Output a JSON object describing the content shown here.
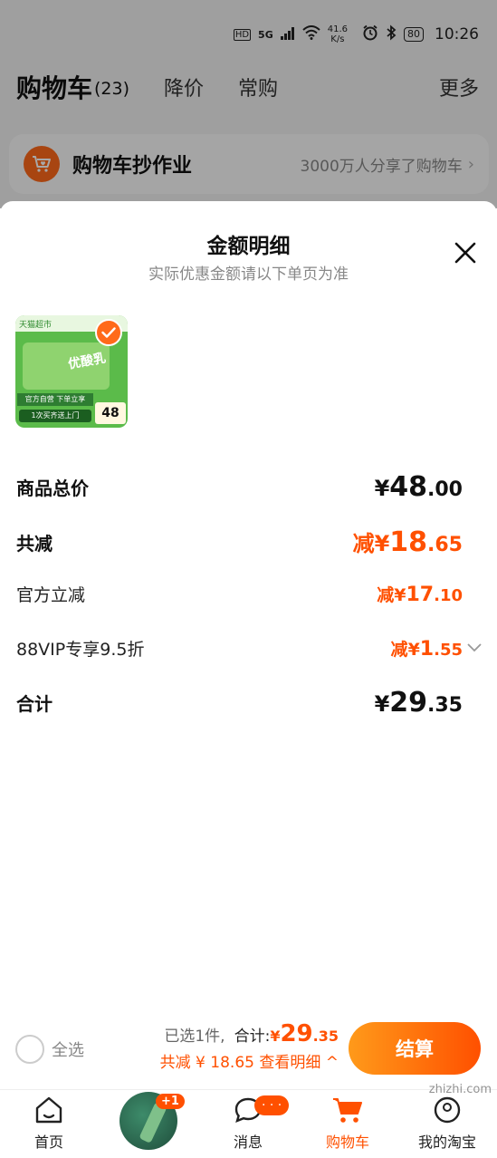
{
  "status_bar": {
    "hd": "HD",
    "signal": "5G",
    "net_speed": "41.6",
    "net_unit": "K/s",
    "battery": "80",
    "time": "10:26"
  },
  "cart": {
    "title": "购物车",
    "count": "(23)",
    "tabs": [
      "降价",
      "常购"
    ],
    "more": "更多"
  },
  "homework": {
    "title": "购物车抄作业",
    "subtitle": "3000万人分享了购物车"
  },
  "sheet": {
    "title": "金额明细",
    "subtitle": "实际优惠金额请以下单页为准",
    "product": {
      "tag": "天猫超市",
      "name": "优酸乳",
      "banner1": "官方自营 下单立享",
      "banner2": "1次买齐送上门",
      "price": "48"
    },
    "rows": [
      {
        "label": "商品总价",
        "yen": "¥",
        "integer": "48",
        "decimal": ".00"
      },
      {
        "label": "共减",
        "prefix": "减",
        "yen": "¥",
        "integer": "18",
        "decimal": ".65"
      },
      {
        "label": "官方立减",
        "prefix": "减",
        "yen": "¥",
        "integer": "17",
        "decimal": ".10"
      },
      {
        "label": "88VIP专享9.5折",
        "prefix": "减",
        "yen": "¥",
        "integer": "1",
        "decimal": ".55"
      },
      {
        "label": "合计",
        "yen": "¥",
        "integer": "29",
        "decimal": ".35"
      }
    ]
  },
  "checkout": {
    "select_all": "全选",
    "selected": "已选1件,",
    "total_label": "合计:",
    "total_yen": "¥",
    "total_int": "29",
    "total_dec": ".35",
    "discount_line": "共减 ¥ 18.65  查看明细 ^",
    "pay_button": "结算"
  },
  "tabbar": {
    "home": "首页",
    "promo_badge": "+1",
    "messages": "消息",
    "messages_badge": "· · ·",
    "cart": "购物车",
    "mine": "我的淘宝"
  },
  "watermark": "zhizhi.com",
  "colors": {
    "accent": "#ff5000",
    "gradient_start": "#ff9a1a"
  }
}
